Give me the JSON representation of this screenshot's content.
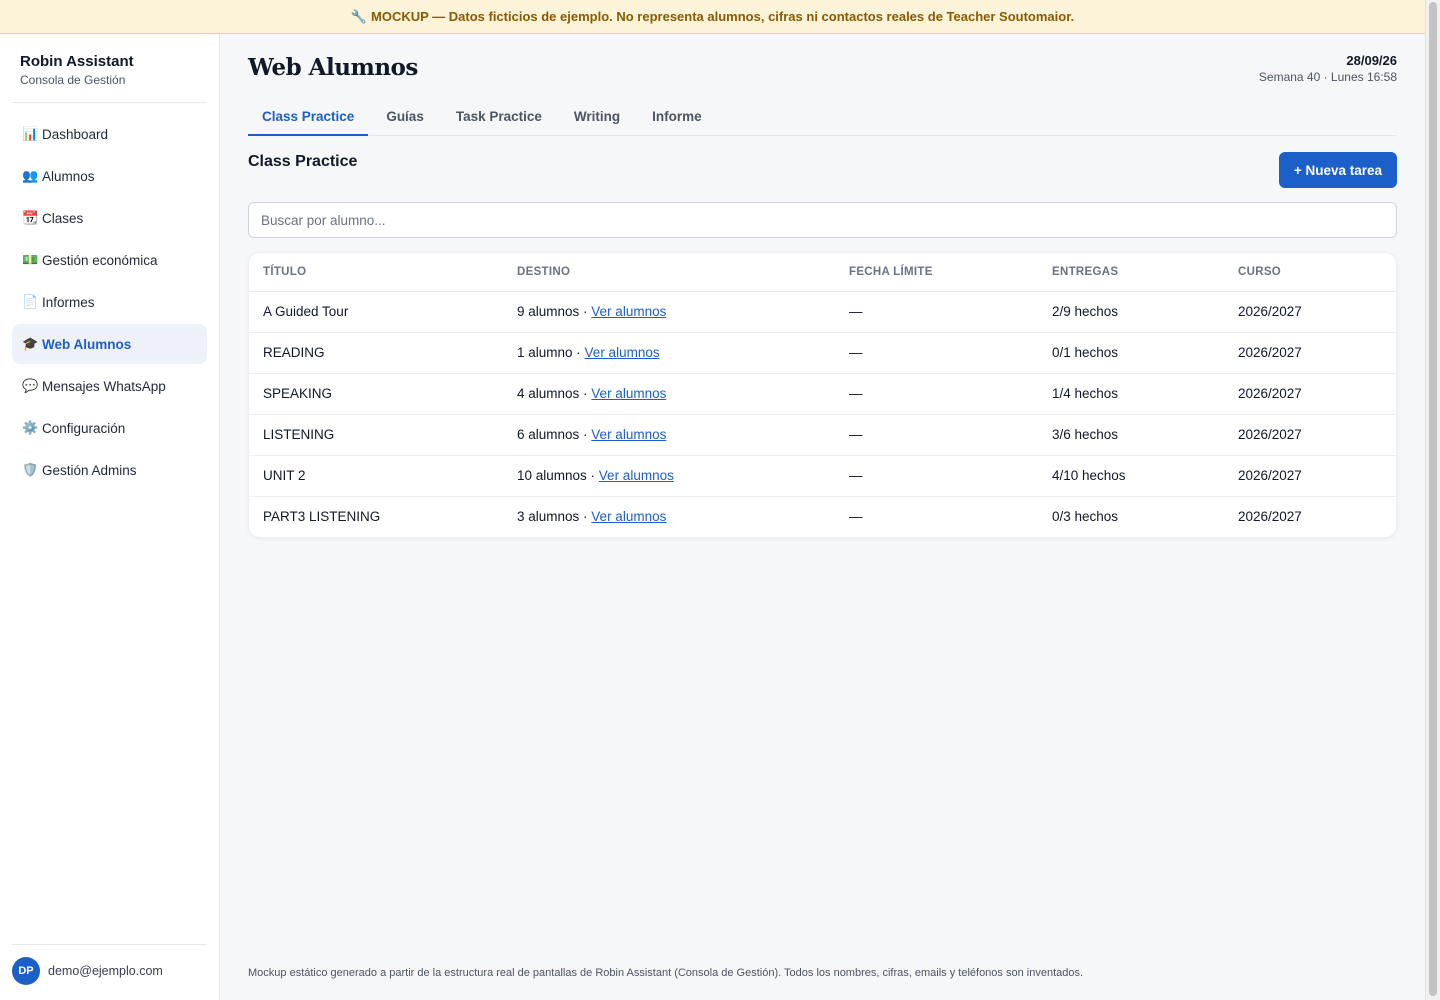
{
  "banner": {
    "icon": "wrench-icon",
    "text": "MOCKUP — Datos ficticios de ejemplo. No representa alumnos, cifras ni contactos reales de Teacher Soutomaior."
  },
  "sidebar": {
    "brand_title": "Robin Assistant",
    "brand_subtitle": "Consola de Gestión",
    "items": [
      {
        "label": "Dashboard",
        "icon": "bar-chart-icon",
        "glyph": "📊",
        "active": false
      },
      {
        "label": "Alumnos",
        "icon": "users-icon",
        "glyph": "👥",
        "active": false
      },
      {
        "label": "Clases",
        "icon": "calendar-icon",
        "glyph": "📆",
        "active": false
      },
      {
        "label": "Gestión económica",
        "icon": "money-icon",
        "glyph": "💵",
        "active": false
      },
      {
        "label": "Informes",
        "icon": "document-icon",
        "glyph": "📄",
        "active": false
      },
      {
        "label": "Web Alumnos",
        "icon": "graduation-cap-icon",
        "glyph": "🎓",
        "active": true
      },
      {
        "label": "Mensajes WhatsApp",
        "icon": "speech-bubble-icon",
        "glyph": "💬",
        "active": false
      },
      {
        "label": "Configuración",
        "icon": "gear-icon",
        "glyph": "⚙️",
        "active": false
      },
      {
        "label": "Gestión Admins",
        "icon": "shield-icon",
        "glyph": "🛡️",
        "active": false
      }
    ],
    "user": {
      "initials": "DP",
      "email": "demo@ejemplo.com"
    }
  },
  "header": {
    "title": "Web Alumnos",
    "date": "28/09/26",
    "week": "Semana 40 · Lunes 16:58"
  },
  "tabs": [
    {
      "label": "Class Practice",
      "active": true
    },
    {
      "label": "Guías",
      "active": false
    },
    {
      "label": "Task Practice",
      "active": false
    },
    {
      "label": "Writing",
      "active": false
    },
    {
      "label": "Informe",
      "active": false
    }
  ],
  "section": {
    "title": "Class Practice",
    "new_button": "+ Nueva tarea",
    "search_placeholder": "Buscar por alumno..."
  },
  "table": {
    "columns": [
      "TÍTULO",
      "DESTINO",
      "FECHA LÍMITE",
      "ENTREGAS",
      "CURSO"
    ],
    "link_label": "Ver alumnos",
    "rows": [
      {
        "title": "A Guided Tour",
        "destino": "9 alumnos · ",
        "fecha": "—",
        "entregas": "2/9 hechos",
        "curso": "2026/2027"
      },
      {
        "title": "READING",
        "destino": "1 alumno · ",
        "fecha": "—",
        "entregas": "0/1 hechos",
        "curso": "2026/2027"
      },
      {
        "title": "SPEAKING",
        "destino": "4 alumnos · ",
        "fecha": "—",
        "entregas": "1/4 hechos",
        "curso": "2026/2027"
      },
      {
        "title": "LISTENING",
        "destino": "6 alumnos · ",
        "fecha": "—",
        "entregas": "3/6 hechos",
        "curso": "2026/2027"
      },
      {
        "title": "UNIT 2",
        "destino": "10 alumnos · ",
        "fecha": "—",
        "entregas": "4/10 hechos",
        "curso": "2026/2027"
      },
      {
        "title": "PART3 LISTENING",
        "destino": "3 alumnos · ",
        "fecha": "—",
        "entregas": "0/3 hechos",
        "curso": "2026/2027"
      }
    ]
  },
  "footer": {
    "text": "Mockup estático generado a partir de la estructura real de pantallas de Robin Assistant (Consola de Gestión). Todos los nombres, cifras, emails y teléfonos son inventados."
  },
  "colors": {
    "accent": "#1d5fc9",
    "banner_bg": "#fdf3d8",
    "banner_text": "#8a5a00"
  }
}
